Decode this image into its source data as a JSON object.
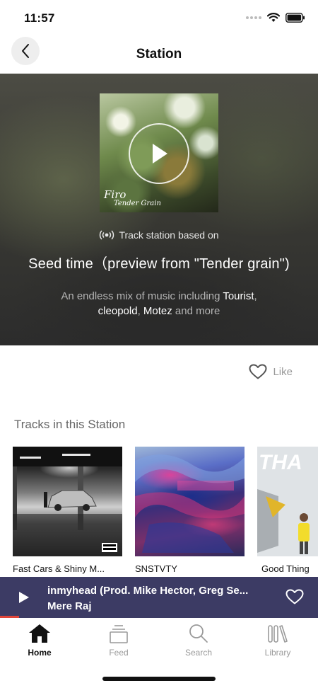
{
  "status_bar": {
    "time": "11:57"
  },
  "header": {
    "title": "Station"
  },
  "hero": {
    "cover_title": "Firo",
    "cover_subtitle": "Tender Grain",
    "station_type": "Track station based on",
    "seed_title": "Seed time（preview from \"Tender grain\")",
    "description_prefix": "An endless mix of music including ",
    "artists": [
      "Tourist",
      "cleopold",
      "Motez"
    ],
    "sep_1": ", ",
    "sep_2": ", ",
    "description_suffix": " and more"
  },
  "like": {
    "label": "Like"
  },
  "tracks_section": {
    "title": "Tracks in this Station",
    "tracks": [
      {
        "label": "Fast Cars & Shiny M..."
      },
      {
        "label": "SNSTVTY"
      },
      {
        "label": "Good Thing",
        "cover_text": "THA"
      }
    ]
  },
  "mini_player": {
    "track": "inmyhead (Prod. Mike Hector, Greg Se...",
    "artist": "Mere Raj",
    "progress": 0.06,
    "accent_color": "#e0453a",
    "background_color": "#3c3b64"
  },
  "tabs": [
    {
      "label": "Home",
      "icon": "home-icon",
      "active": true
    },
    {
      "label": "Feed",
      "icon": "feed-icon",
      "active": false
    },
    {
      "label": "Search",
      "icon": "search-icon",
      "active": false
    },
    {
      "label": "Library",
      "icon": "library-icon",
      "active": false
    }
  ]
}
